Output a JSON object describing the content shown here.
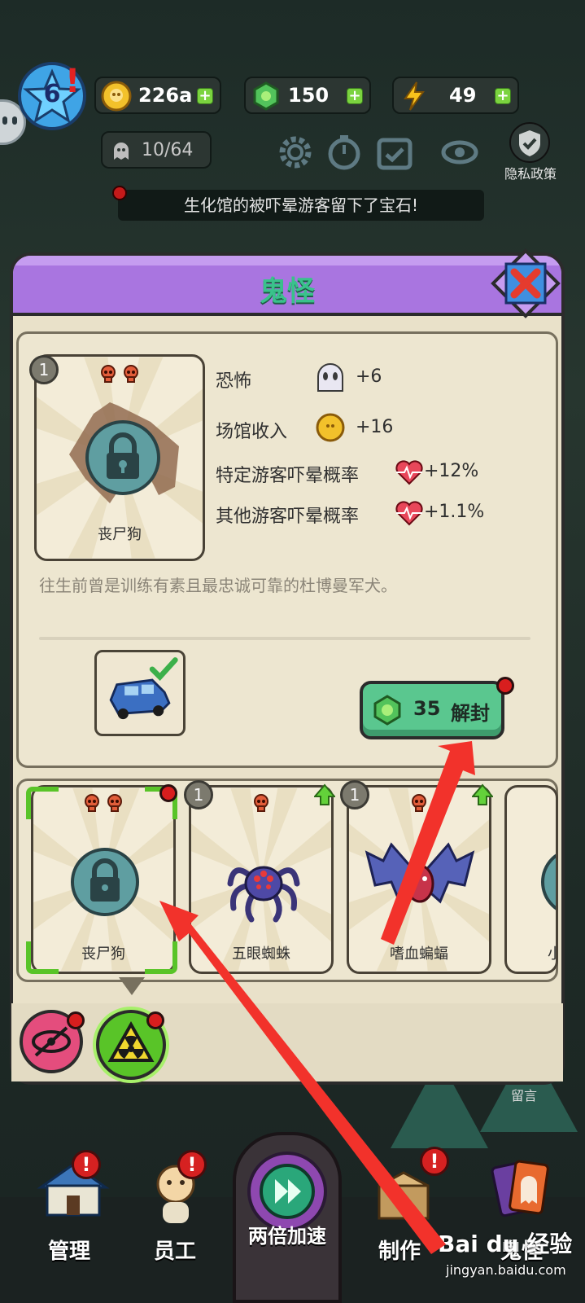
{
  "hud": {
    "level": "6",
    "coins": "226a",
    "gems": "150",
    "energy": "49",
    "ghost_count": "10/64",
    "privacy_label": "隐私政策",
    "notice": "生化馆的被吓晕游客留下了宝石!"
  },
  "panel": {
    "title": "鬼怪",
    "selected": {
      "level": "1",
      "name": "丧尸狗",
      "skull_count": 2,
      "stats": [
        {
          "label": "恐怖",
          "value": "+6",
          "icon": "ghost-face-icon"
        },
        {
          "label": "场馆收入",
          "value": "+16",
          "icon": "coin-icon"
        },
        {
          "label": "特定游客吓晕概率",
          "value": "+12%",
          "icon": "heartbeat-icon"
        },
        {
          "label": "其他游客吓晕概率",
          "value": "+1.1%",
          "icon": "heartbeat-icon"
        }
      ],
      "description": "往生前曾是训练有素且最忠诚可靠的杜博曼军犬。",
      "requirement_icon": "blue-car-icon",
      "unlock_cost": "35",
      "unlock_label": "解封"
    },
    "monsters": [
      {
        "name": "丧尸狗",
        "locked": true,
        "skulls": 2
      },
      {
        "name": "五眼蜘蛛",
        "level": "1",
        "skulls": 1,
        "upgrade": true
      },
      {
        "name": "嗜血蝙蝠",
        "level": "1",
        "skulls": 1,
        "upgrade": true
      },
      {
        "name": "小",
        "locked": true
      }
    ]
  },
  "bottom_nav": {
    "manage": "管理",
    "staff": "员工",
    "speed": "两倍加速",
    "craft": "制作",
    "ghost": "鬼怪",
    "leave_message": "留言"
  },
  "watermark": {
    "brand": "Bai du 经验",
    "url": "jingyan.baidu.com"
  },
  "colors": {
    "header_purple": "#a975e0",
    "title_green": "#39c28b",
    "unlock_green": "#5ac78f",
    "alert_red": "#d81e1e",
    "select_green": "#59c428",
    "arrow_red": "#f2322b"
  }
}
